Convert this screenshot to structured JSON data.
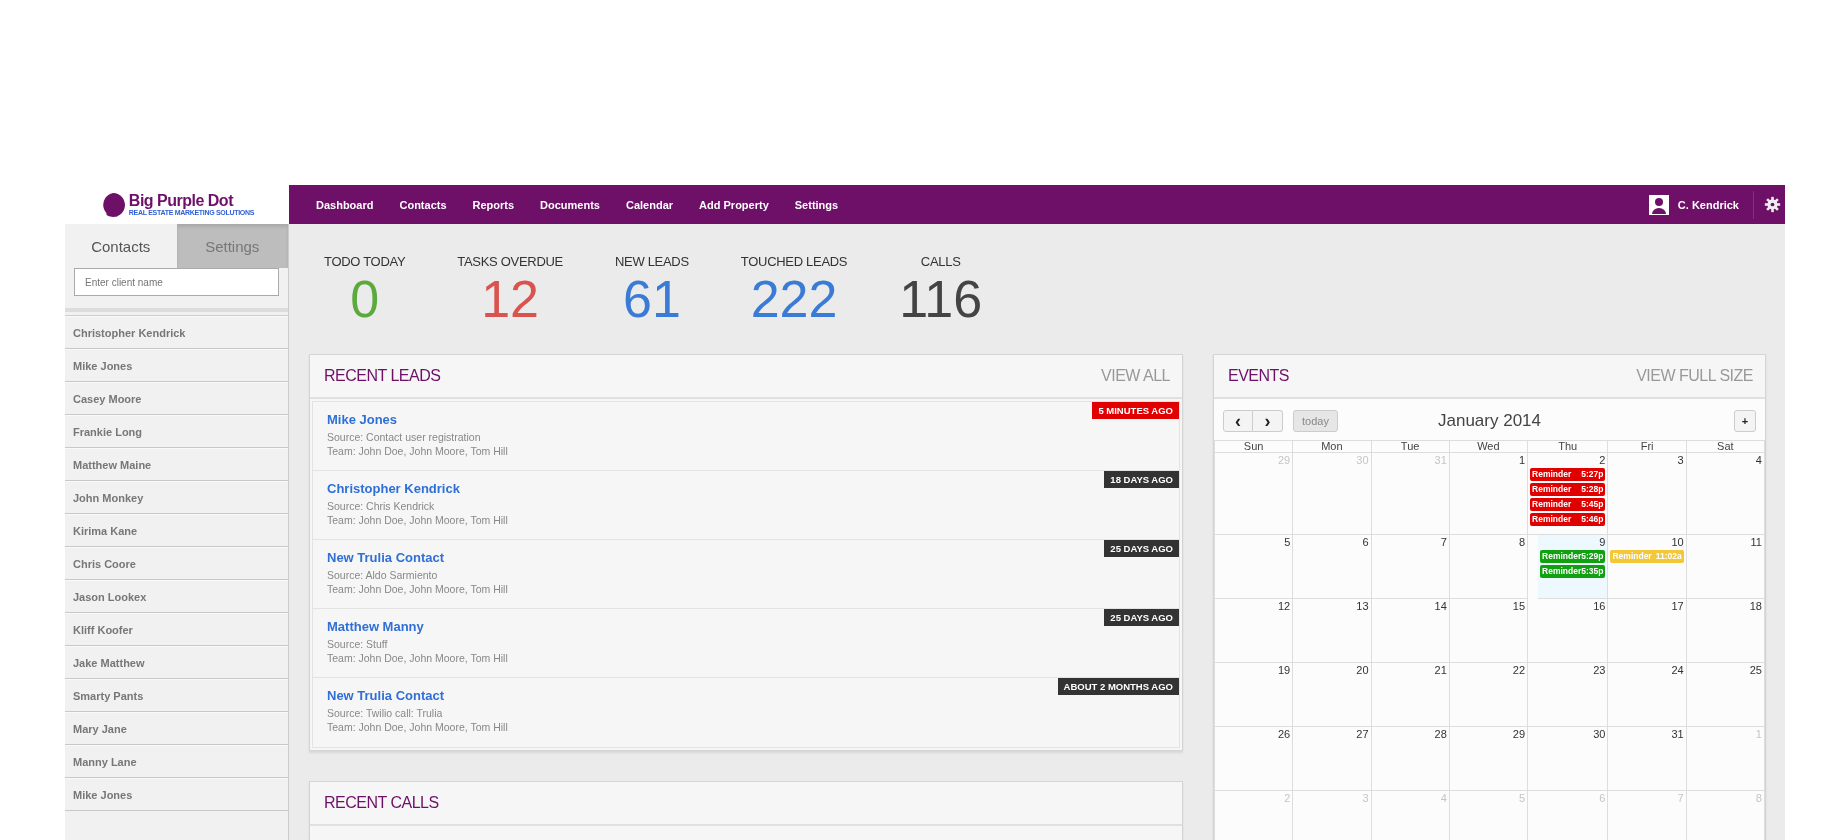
{
  "logo": {
    "name": "Big Purple Dot",
    "tagline": "REAL ESTATE MARKETING SOLUTIONS"
  },
  "nav": {
    "items": [
      "Dashboard",
      "Contacts",
      "Reports",
      "Documents",
      "Calendar",
      "Add Property",
      "Settings"
    ],
    "user": "C. Kendrick"
  },
  "sidebar": {
    "tabs": [
      {
        "label": "Contacts",
        "selected": true
      },
      {
        "label": "Settings",
        "selected": false
      }
    ],
    "search": {
      "placeholder": "Enter client name"
    },
    "contacts": [
      "Christopher Kendrick",
      "Mike Jones",
      "Casey Moore",
      "Frankie Long",
      "Matthew Maine",
      "John Monkey",
      "Kirima Kane",
      "Chris Coore",
      "Jason Lookex",
      "Kliff Koofer",
      "Jake Matthew",
      "Smarty Pants",
      "Mary Jane",
      "Manny Lane",
      "Mike Jones"
    ]
  },
  "stats": [
    {
      "label": "TODO TODAY",
      "value": "0",
      "color": "#5aab3c"
    },
    {
      "label": "TASKS OVERDUE",
      "value": "12",
      "color": "#d9534f"
    },
    {
      "label": "NEW LEADS",
      "value": "61",
      "color": "#3a7bd5"
    },
    {
      "label": "TOUCHED LEADS",
      "value": "222",
      "color": "#3a7bd5"
    },
    {
      "label": "CALLS",
      "value": "116",
      "color": "#444444"
    }
  ],
  "recent_leads": {
    "title": "RECENT LEADS",
    "link": "VIEW ALL",
    "items": [
      {
        "name": "Mike Jones",
        "source": "Source: Contact user registration",
        "team": "Team: John Doe, John Moore, Tom Hill",
        "age": "5 MINUTES AGO",
        "color": "#e00000"
      },
      {
        "name": "Christopher Kendrick",
        "source": "Source: Chris Kendrick",
        "team": "Team: John Doe, John Moore, Tom Hill",
        "age": "18 DAYS AGO",
        "color": "#333333"
      },
      {
        "name": "New Trulia Contact",
        "source": "Source: Aldo Sarmiento",
        "team": "Team: John Doe, John Moore, Tom Hill",
        "age": "25 DAYS AGO",
        "color": "#333333"
      },
      {
        "name": "Matthew Manny",
        "source": "Source: Stuff",
        "team": "Team: John Doe, John Moore, Tom Hill",
        "age": "25 DAYS AGO",
        "color": "#333333"
      },
      {
        "name": "New Trulia Contact",
        "source": "Source: Twilio call: Trulia",
        "team": "Team: John Doe, John Moore, Tom Hill",
        "age": "ABOUT 2 MONTHS AGO",
        "color": "#333333"
      }
    ]
  },
  "recent_calls": {
    "title": "RECENT CALLS"
  },
  "events": {
    "title": "EVENTS",
    "link": "VIEW FULL SIZE",
    "prev": "‹",
    "next": "›",
    "today": "today",
    "add": "+",
    "month": "January 2014",
    "weekdays": [
      "Sun",
      "Mon",
      "Tue",
      "Wed",
      "Thu",
      "Fri",
      "Sat"
    ],
    "weeks": [
      [
        {
          "day": "29",
          "other_month": true,
          "today": false
        },
        {
          "day": "30",
          "other_month": true,
          "today": false
        },
        {
          "day": "31",
          "other_month": true,
          "today": false
        },
        {
          "day": "1",
          "other_month": false,
          "today": false
        },
        {
          "day": "2",
          "other_month": false,
          "today": false,
          "events": [
            {
              "title": "Reminder",
              "time": "5:27p",
              "color": "#e00000"
            },
            {
              "title": "Reminder",
              "time": "5:28p",
              "color": "#e00000"
            },
            {
              "title": "Reminder",
              "time": "5:45p",
              "color": "#e00000"
            },
            {
              "title": "Reminder",
              "time": "5:46p",
              "color": "#e00000"
            }
          ]
        },
        {
          "day": "3",
          "other_month": false,
          "today": false
        },
        {
          "day": "4",
          "other_month": false,
          "today": false
        }
      ],
      [
        {
          "day": "5",
          "other_month": false,
          "today": false
        },
        {
          "day": "6",
          "other_month": false,
          "today": false
        },
        {
          "day": "7",
          "other_month": false,
          "today": false
        },
        {
          "day": "8",
          "other_month": false,
          "today": false
        },
        {
          "day": "9",
          "other_month": false,
          "today": true,
          "events": [
            {
              "title": "Reminder",
              "time": "5:29p",
              "color": "#10a010"
            },
            {
              "title": "Reminder",
              "time": "5:35p",
              "color": "#10a010"
            }
          ]
        },
        {
          "day": "10",
          "other_month": false,
          "today": false,
          "events": [
            {
              "title": "Reminder",
              "time": "11:02a",
              "color": "#f2c83a"
            }
          ]
        },
        {
          "day": "11",
          "other_month": false,
          "today": false
        }
      ],
      [
        {
          "day": "12",
          "other_month": false,
          "today": false
        },
        {
          "day": "13",
          "other_month": false,
          "today": false
        },
        {
          "day": "14",
          "other_month": false,
          "today": false
        },
        {
          "day": "15",
          "other_month": false,
          "today": false
        },
        {
          "day": "16",
          "other_month": false,
          "today": false
        },
        {
          "day": "17",
          "other_month": false,
          "today": false
        },
        {
          "day": "18",
          "other_month": false,
          "today": false
        }
      ],
      [
        {
          "day": "19",
          "other_month": false,
          "today": false
        },
        {
          "day": "20",
          "other_month": false,
          "today": false
        },
        {
          "day": "21",
          "other_month": false,
          "today": false
        },
        {
          "day": "22",
          "other_month": false,
          "today": false
        },
        {
          "day": "23",
          "other_month": false,
          "today": false
        },
        {
          "day": "24",
          "other_month": false,
          "today": false
        },
        {
          "day": "25",
          "other_month": false,
          "today": false
        }
      ],
      [
        {
          "day": "26",
          "other_month": false,
          "today": false
        },
        {
          "day": "27",
          "other_month": false,
          "today": false
        },
        {
          "day": "28",
          "other_month": false,
          "today": false
        },
        {
          "day": "29",
          "other_month": false,
          "today": false
        },
        {
          "day": "30",
          "other_month": false,
          "today": false
        },
        {
          "day": "31",
          "other_month": false,
          "today": false
        },
        {
          "day": "1",
          "other_month": true,
          "today": false
        }
      ],
      [
        {
          "day": "2",
          "other_month": true,
          "today": false
        },
        {
          "day": "3",
          "other_month": true,
          "today": false
        },
        {
          "day": "4",
          "other_month": true,
          "today": false
        },
        {
          "day": "5",
          "other_month": true,
          "today": false
        },
        {
          "day": "6",
          "other_month": true,
          "today": false
        },
        {
          "day": "7",
          "other_month": true,
          "today": false
        },
        {
          "day": "8",
          "other_month": true,
          "today": false
        }
      ]
    ]
  }
}
